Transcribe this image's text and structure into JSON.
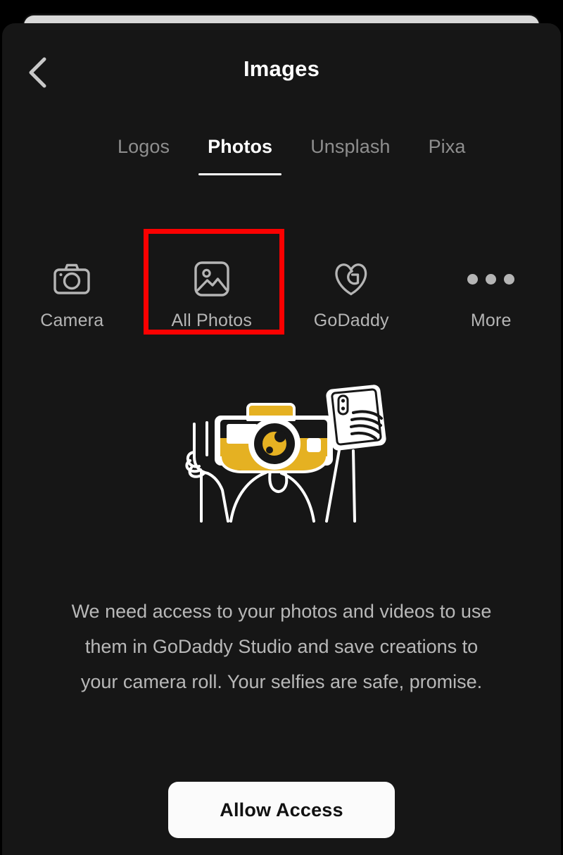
{
  "window": {
    "background_color": "#000000",
    "sheet_color": "#161616",
    "peek_card_color": "#d8d8d8"
  },
  "header": {
    "title": "Images",
    "back_icon": "chevron-left-icon"
  },
  "tabs": {
    "items": [
      {
        "label": "Logos",
        "active": false
      },
      {
        "label": "Photos",
        "active": true
      },
      {
        "label": "Unsplash",
        "active": false
      },
      {
        "label": "Pixa",
        "active": false
      }
    ],
    "active_index": 1,
    "active_color": "#ffffff",
    "inactive_color": "#8e8e8e"
  },
  "sources": {
    "items": [
      {
        "label": "Camera",
        "icon": "camera-icon"
      },
      {
        "label": "All Photos",
        "icon": "image-photo-icon"
      },
      {
        "label": "GoDaddy",
        "icon": "godaddy-logo-icon"
      },
      {
        "label": "More",
        "icon": "ellipsis-icon"
      }
    ]
  },
  "annotation": {
    "type": "highlight-rectangle",
    "target": "All Photos",
    "color": "#fb0000"
  },
  "illustration": {
    "name": "person-with-camera-head-taking-selfie",
    "accent_color": "#e5b122",
    "line_color": "#ffffff"
  },
  "permission": {
    "body": "We need access to your photos and videos to use them in GoDaddy Studio and save creations to your camera roll. Your selfies are safe, promise.",
    "cta_label": "Allow Access"
  }
}
